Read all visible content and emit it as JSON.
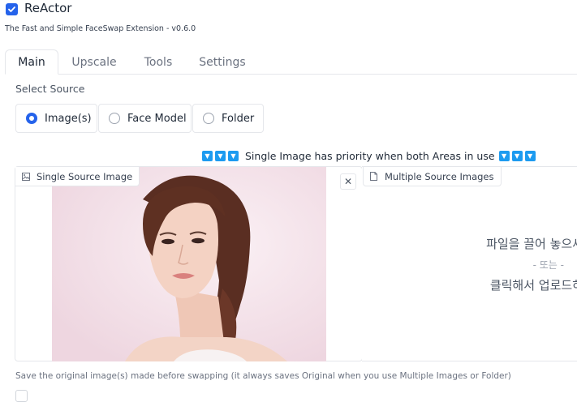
{
  "header": {
    "title": "ReActor",
    "subtitle": "The Fast and Simple FaceSwap Extension - v0.6.0",
    "enabled": true
  },
  "tabs": [
    {
      "label": "Main",
      "active": true
    },
    {
      "label": "Upscale",
      "active": false
    },
    {
      "label": "Tools",
      "active": false
    },
    {
      "label": "Settings",
      "active": false
    }
  ],
  "source": {
    "label": "Select Source",
    "options": [
      {
        "label": "Image(s)",
        "selected": true
      },
      {
        "label": "Face Model",
        "selected": false
      },
      {
        "label": "Folder",
        "selected": false
      }
    ]
  },
  "priority_note": "Single Image has priority when both Areas in use",
  "single_source": {
    "label": "Single Source Image",
    "close_glyph": "✕"
  },
  "multiple_source": {
    "label": "Multiple Source Images",
    "drop_line1": "파일을 끌어 놓으세",
    "drop_line2": "- 또는 -",
    "drop_line3": "클릭해서 업로드하"
  },
  "footer_note": "Save the original image(s) made before swapping (it always saves Original when you use Multiple Images or Folder)",
  "colors": {
    "accent": "#2563eb",
    "triangle": "#1d9bf0"
  }
}
